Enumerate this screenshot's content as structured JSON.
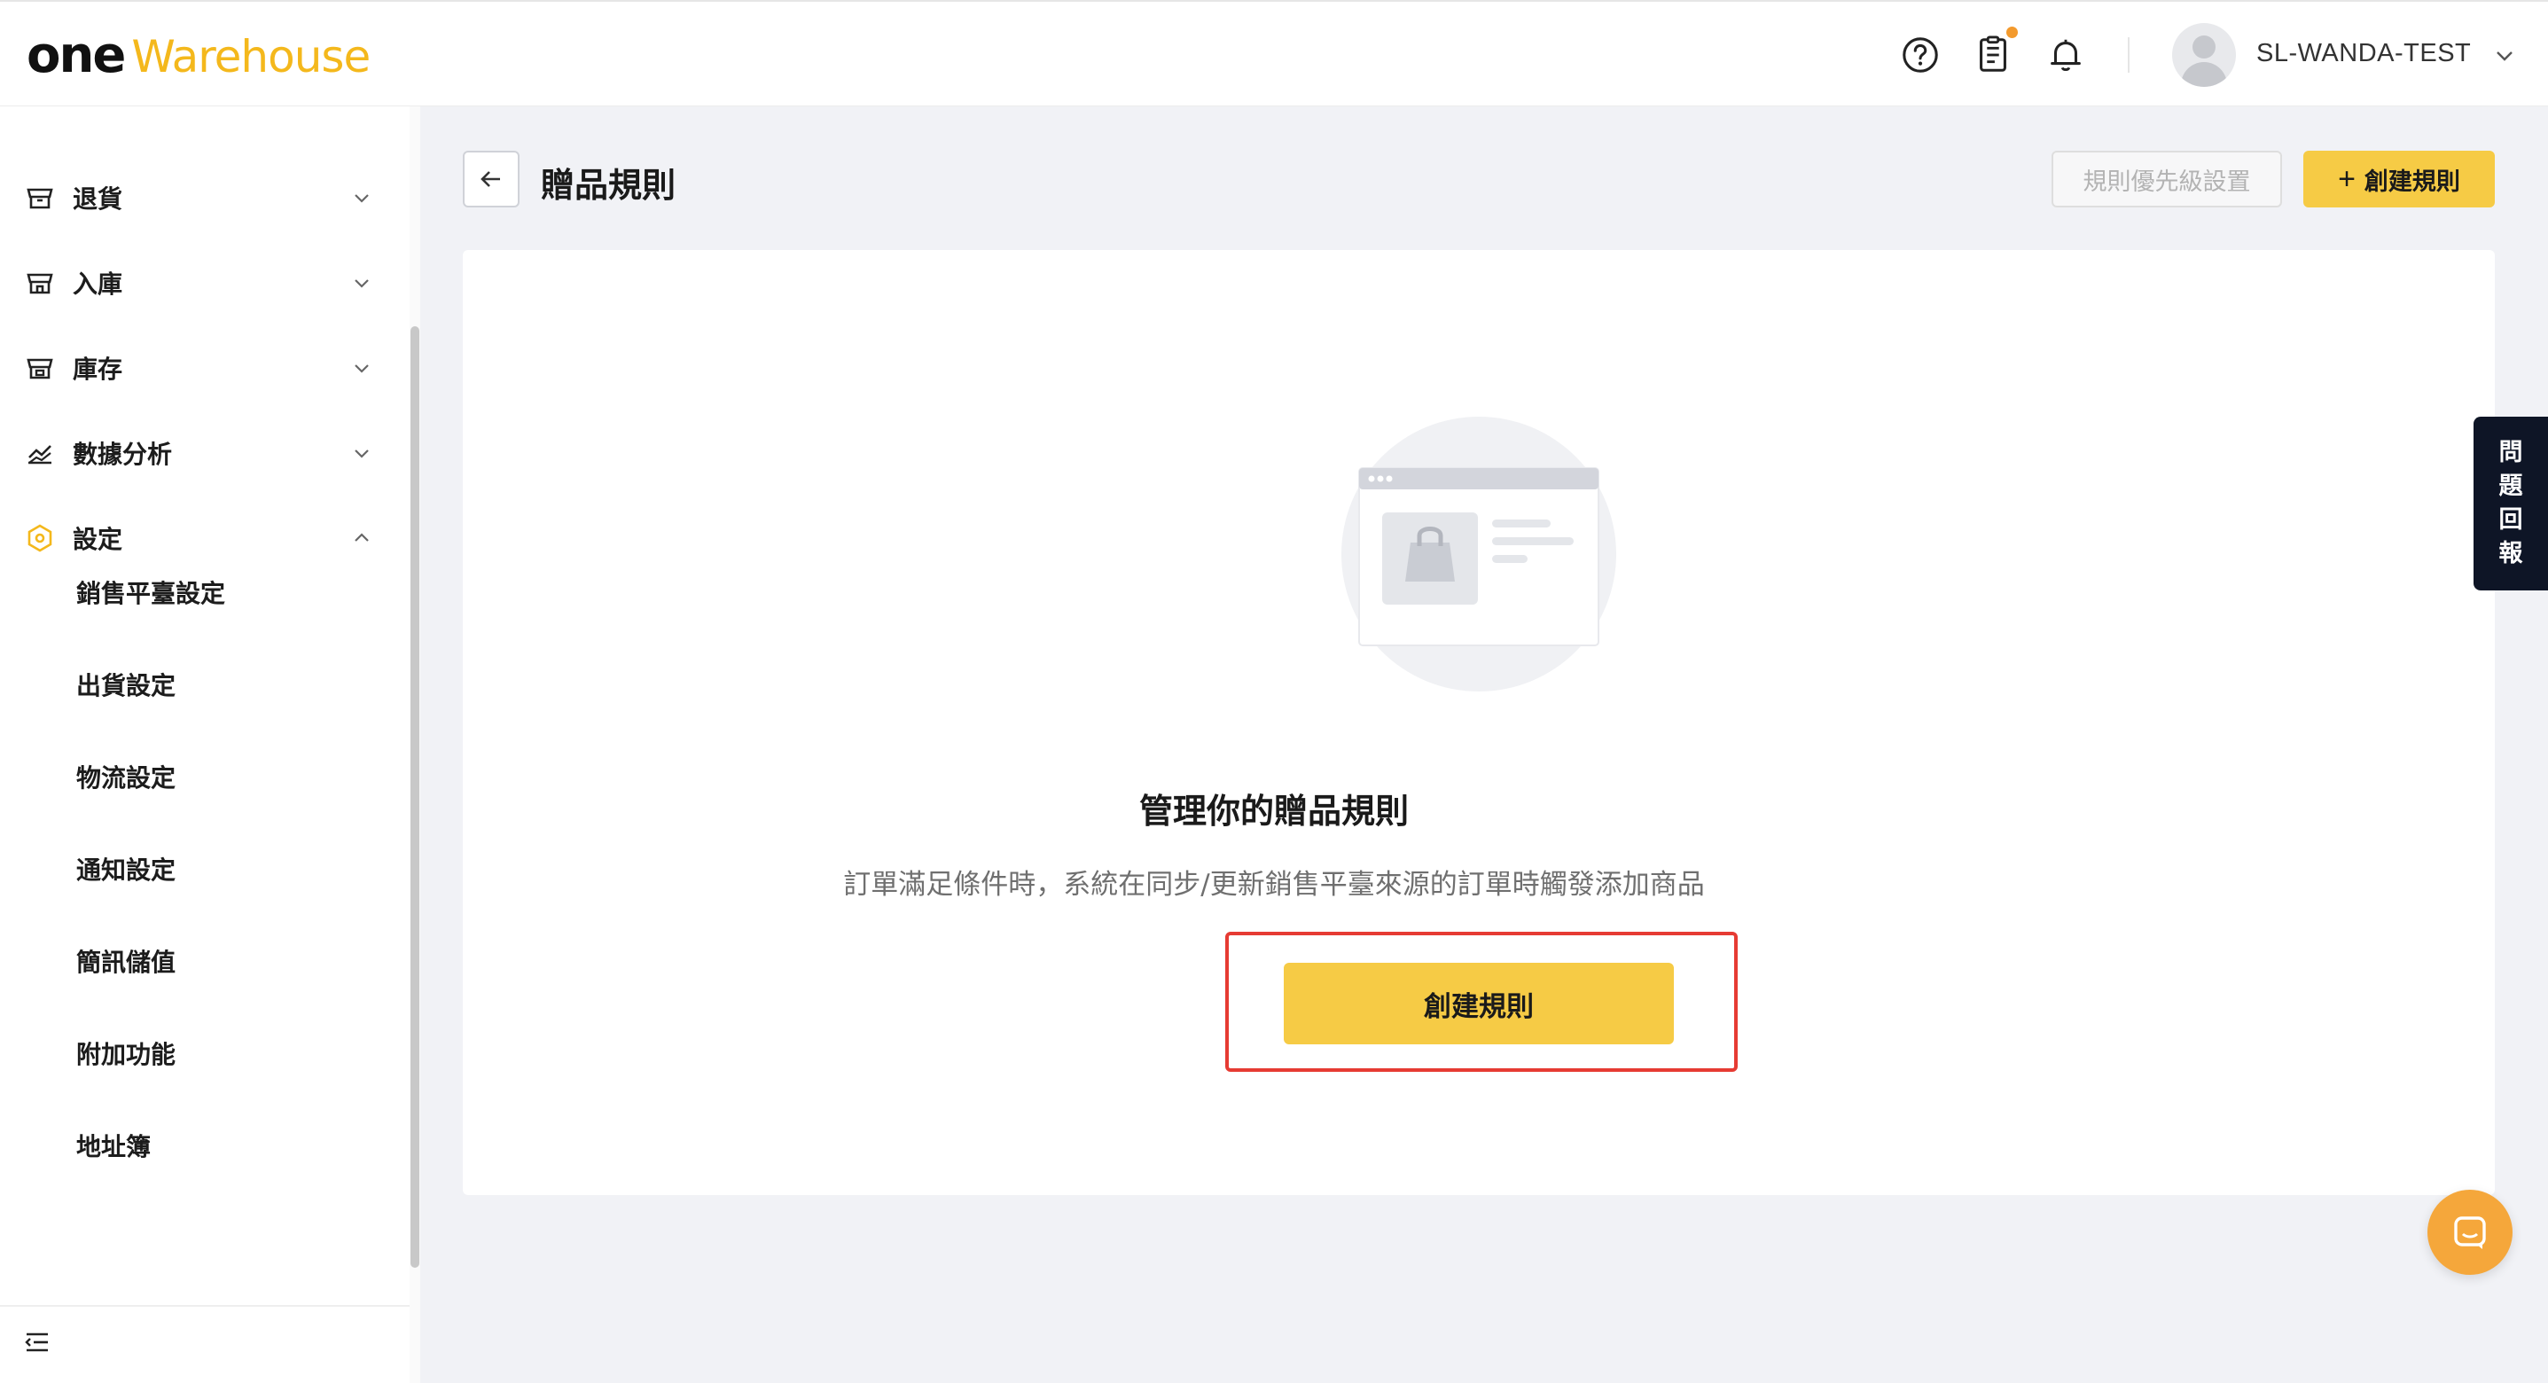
{
  "header": {
    "logo": {
      "one": "one",
      "warehouse": "Warehouse"
    },
    "icons": [
      "help-icon",
      "tasks-icon",
      "bell-icon"
    ],
    "username": "SL-WANDA-TEST"
  },
  "sidebar": {
    "items": [
      {
        "label": "退貨",
        "icon": "store-icon",
        "expanded": false
      },
      {
        "label": "入庫",
        "icon": "store-icon",
        "expanded": false
      },
      {
        "label": "庫存",
        "icon": "store-icon",
        "expanded": false
      },
      {
        "label": "數據分析",
        "icon": "chart-icon",
        "expanded": false
      },
      {
        "label": "設定",
        "icon": "settings-hex-icon",
        "expanded": true
      }
    ],
    "sub_items": [
      "銷售平臺設定",
      "出貨設定",
      "物流設定",
      "通知設定",
      "簡訊儲值",
      "附加功能",
      "地址簿"
    ]
  },
  "page": {
    "title": "贈品規則",
    "priority_button": "規則優先級設置",
    "create_button": "創建規則"
  },
  "empty_state": {
    "title": "管理你的贈品規則",
    "description": "訂單滿足條件時，系統在同步/更新銷售平臺來源的訂單時觸發添加商品",
    "button": "創建規則"
  },
  "feedback": {
    "chars": [
      "問",
      "題",
      "回",
      "報"
    ]
  },
  "colors": {
    "accent": "#f6cb45",
    "brand": "#f4b81c",
    "highlight": "#e63b33",
    "feedback_bg": "#0e1526",
    "chat": "#f5a73b"
  }
}
